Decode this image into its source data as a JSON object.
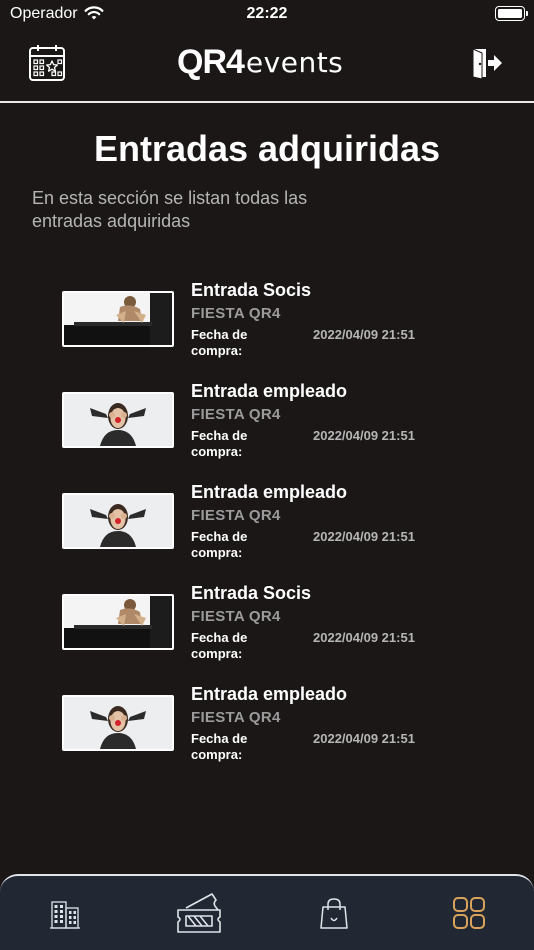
{
  "status_bar": {
    "carrier": "Operador",
    "time": "22:22"
  },
  "header": {
    "logo_primary": "QR4",
    "logo_secondary": "events",
    "calendar_icon": "calendar-star-icon",
    "logout_icon": "logout-door-icon"
  },
  "page": {
    "title": "Entradas adquiridas",
    "description": "En esta sección se listan todas las entradas adquiridas"
  },
  "tickets": [
    {
      "name": "Entrada Socis",
      "event": "FIESTA QR4",
      "date_label": "Fecha de compra:",
      "date": "2022/04/09 21:51",
      "image": "person-crouching-on-piano-photo"
    },
    {
      "name": "Entrada empleado",
      "event": "FIESTA QR4",
      "date_label": "Fecha de compra:",
      "date": "2022/04/09 21:51",
      "image": "person-with-clown-nose-photo"
    },
    {
      "name": "Entrada empleado",
      "event": "FIESTA QR4",
      "date_label": "Fecha de compra:",
      "date": "2022/04/09 21:51",
      "image": "person-with-clown-nose-photo"
    },
    {
      "name": "Entrada Socis",
      "event": "FIESTA QR4",
      "date_label": "Fecha de compra:",
      "date": "2022/04/09 21:51",
      "image": "person-crouching-on-piano-photo"
    },
    {
      "name": "Entrada empleado",
      "event": "FIESTA QR4",
      "date_label": "Fecha de compra:",
      "date": "2022/04/09 21:51",
      "image": "person-with-clown-nose-photo"
    }
  ],
  "tab_bar": {
    "tabs": [
      {
        "icon": "building-icon",
        "active": false
      },
      {
        "icon": "ticket-icon",
        "active": false
      },
      {
        "icon": "shopping-bag-icon",
        "active": false
      },
      {
        "icon": "grid-icon",
        "active": true
      }
    ],
    "colors": {
      "inactive": "#dfe3ea",
      "active": "#d9a35b"
    }
  }
}
